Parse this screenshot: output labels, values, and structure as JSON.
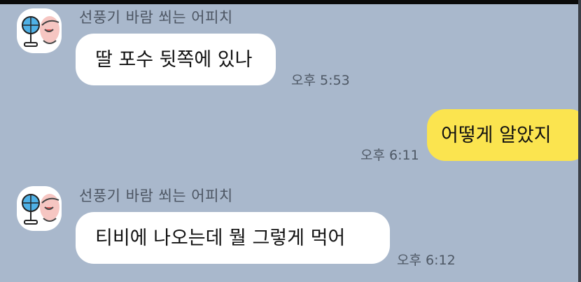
{
  "messages": [
    {
      "sender": "선풍기 바람 쐬는 어피치",
      "text": "딸 포수 뒷쪽에 있나",
      "time": "오후 5:53"
    },
    {
      "text": "어떻게 알았지",
      "time": "오후 6:11"
    },
    {
      "sender": "선풍기 바람 쐬는 어피치",
      "text": "티비에 나오는데 뭘 그렇게 먹어",
      "time": "오후 6:12"
    }
  ],
  "colors": {
    "background": "#a9b8cc",
    "incoming_bubble": "#ffffff",
    "outgoing_bubble": "#fbe44f"
  },
  "avatar_icon": "apeach-fan-icon"
}
